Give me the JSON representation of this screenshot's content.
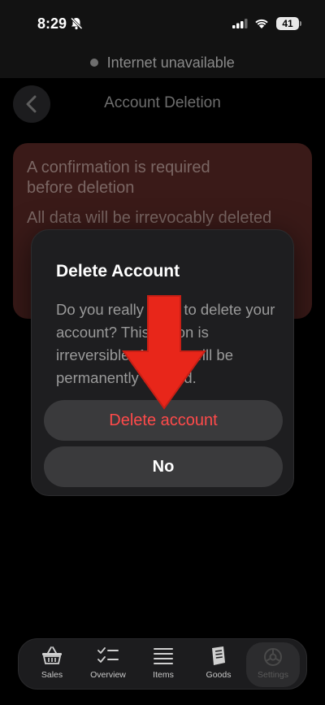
{
  "status_bar": {
    "time": "8:29",
    "battery": "41",
    "icons": [
      "bell-slash-icon",
      "cellular-signal-icon",
      "wifi-icon",
      "battery-icon"
    ]
  },
  "offline_banner": {
    "text": "Internet unavailable"
  },
  "header": {
    "title": "Account Deletion",
    "back_icon": "chevron-left-icon"
  },
  "warning_card": {
    "line1": "A confirmation is required",
    "line2": "before deletion",
    "line3": "All data will be irrevocably deleted"
  },
  "dialog": {
    "title": "Delete Account",
    "message": "Do you really want to delete your account? This action is irreversible. All data will be permanently deleted.",
    "delete_label": "Delete account",
    "no_label": "No"
  },
  "colors": {
    "destructive": "#ff4a4a",
    "annotation_arrow": "#e8261a"
  },
  "tabs": [
    {
      "label": "Sales",
      "icon": "basket-icon"
    },
    {
      "label": "Overview",
      "icon": "checklist-icon"
    },
    {
      "label": "Items",
      "icon": "menu-icon"
    },
    {
      "label": "Goods",
      "icon": "book-icon"
    },
    {
      "label": "Settings",
      "icon": "gear-icon",
      "active": true
    }
  ]
}
